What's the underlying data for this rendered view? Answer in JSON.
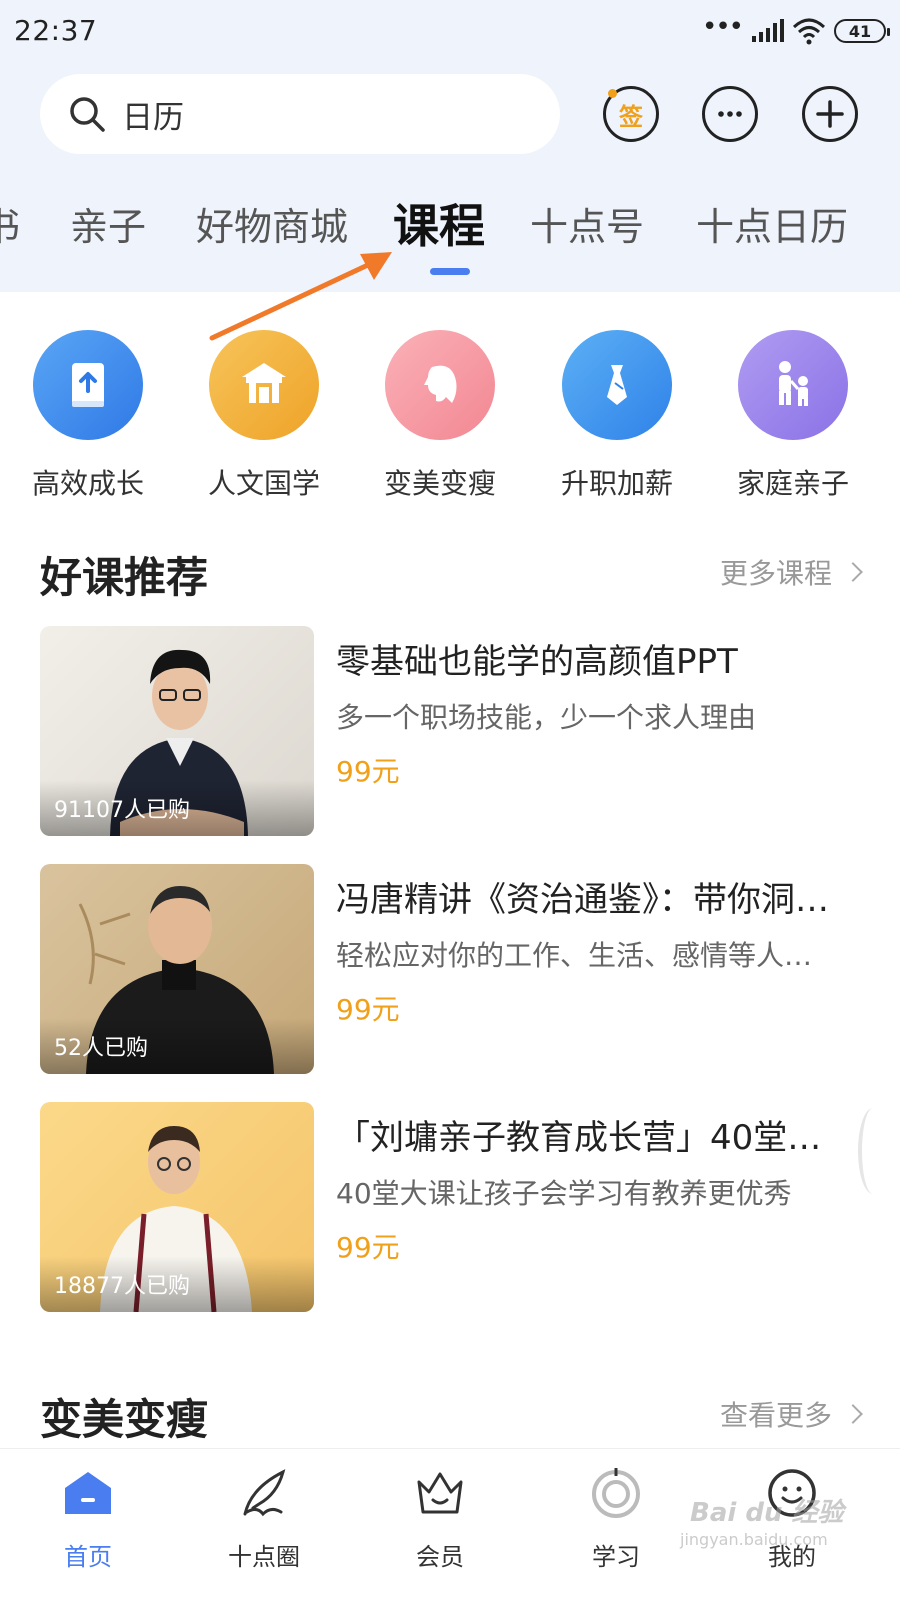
{
  "status": {
    "time": "22:37",
    "battery": "41"
  },
  "search": {
    "text": "日历"
  },
  "header": {
    "signin_char": "签"
  },
  "tabs": [
    {
      "label": "书"
    },
    {
      "label": "亲子"
    },
    {
      "label": "好物商城"
    },
    {
      "label": "课程"
    },
    {
      "label": "十点号"
    },
    {
      "label": "十点日历"
    }
  ],
  "categories": [
    {
      "label": "高效成长",
      "icon": "book-upload-icon",
      "color": "#3f8ef0"
    },
    {
      "label": "人文国学",
      "icon": "pavilion-icon",
      "color": "#f2b13c"
    },
    {
      "label": "变美变瘦",
      "icon": "woman-face-icon",
      "color": "#f79aa6"
    },
    {
      "label": "升职加薪",
      "icon": "tie-icon",
      "color": "#4a9bf0"
    },
    {
      "label": "家庭亲子",
      "icon": "parent-child-icon",
      "color": "#9b86ec"
    }
  ],
  "section1": {
    "title": "好课推荐",
    "more": "更多课程"
  },
  "courses": [
    {
      "title": "零基础也能学的高颜值PPT",
      "subtitle": "多一个职场技能，少一个求人理由",
      "price": "99元",
      "buyers": "91107人已购"
    },
    {
      "title": "冯唐精讲《资治通鉴》：带你洞…",
      "subtitle": "轻松应对你的工作、生活、感情等人…",
      "price": "99元",
      "buyers": "52人已购"
    },
    {
      "title": "「刘墉亲子教育成长营」40堂…",
      "subtitle": "40堂大课让孩子会学习有教养更优秀",
      "price": "99元",
      "buyers": "18877人已购"
    }
  ],
  "section2": {
    "title": "变美变瘦",
    "more": "查看更多"
  },
  "nav": [
    {
      "label": "首页",
      "icon": "home-icon"
    },
    {
      "label": "十点圈",
      "icon": "feather-icon"
    },
    {
      "label": "会员",
      "icon": "crown-icon"
    },
    {
      "label": "学习",
      "icon": "study-icon"
    },
    {
      "label": "我的",
      "icon": "smile-icon"
    }
  ],
  "colors": {
    "accent": "#4a7ef0",
    "price": "#f0a01a",
    "arrow": "#f07a2a"
  },
  "watermark": {
    "text": "Bai du 经验",
    "sub": "jingyan.baidu.com"
  }
}
